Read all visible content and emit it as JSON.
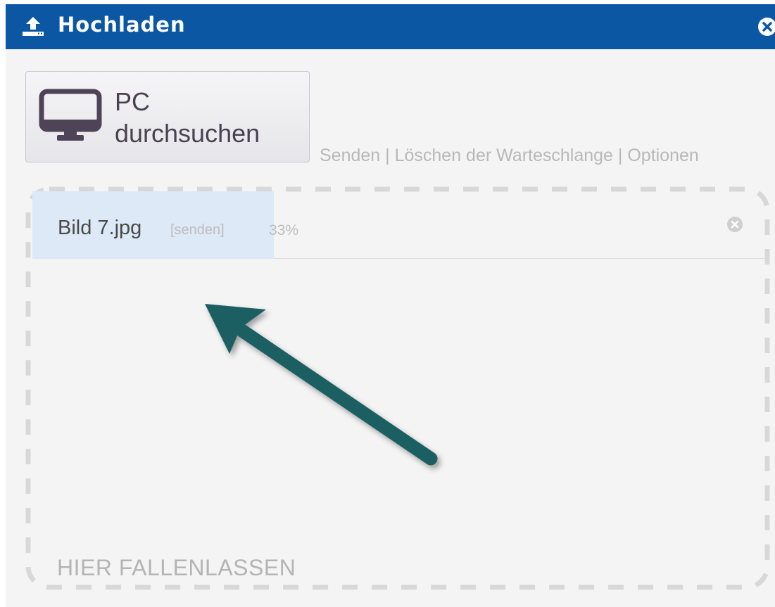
{
  "dialog": {
    "title": "Hochladen",
    "title_icon": "upload-icon",
    "close_icon": "close-icon",
    "titlebar_color": "#0b57a4"
  },
  "toolbar": {
    "browse_line1": "PC",
    "browse_line2": "durchsuchen",
    "browse_icon": "monitor-icon",
    "send": "Senden",
    "clear_queue": "Löschen der Warteschlange",
    "options": "Optionen",
    "separator": " | "
  },
  "queue": {
    "items": [
      {
        "name": "Bild 7.jpg",
        "status": "[senden]",
        "percent_label": "33%",
        "progress": 0.33,
        "remove_icon": "remove-icon"
      }
    ]
  },
  "dropzone": {
    "label": "HIER FALLENLASSEN"
  },
  "annotation": {
    "arrow_icon": "arrow-pointer-icon",
    "arrow_color": "#1d5e63"
  }
}
